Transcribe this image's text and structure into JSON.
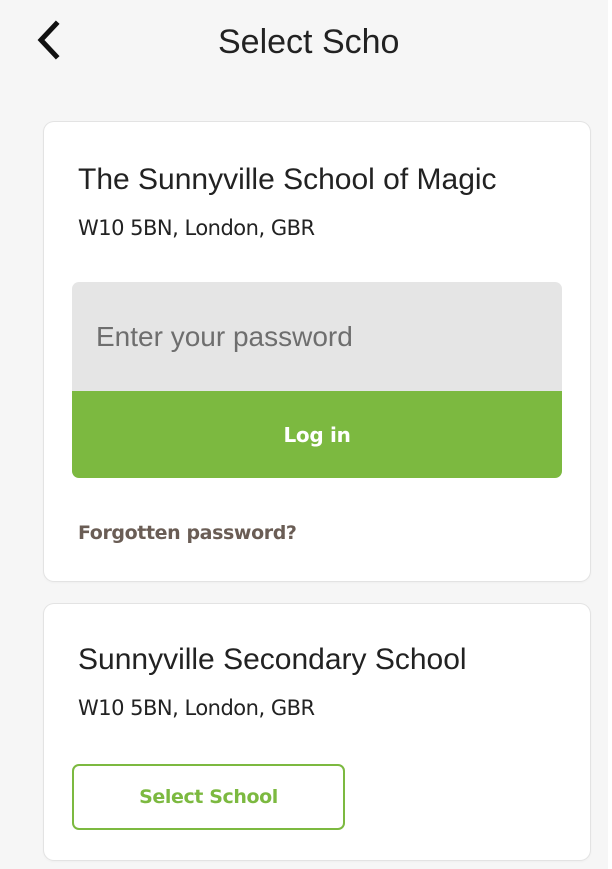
{
  "header": {
    "title": "Select Scho",
    "back_icon": "chevron-left-icon"
  },
  "schools": [
    {
      "name": "The Sunnyville School of Magic",
      "address": "W10 5BN, London, GBR",
      "password_placeholder": "Enter your password",
      "password_value": "",
      "login_label": "Log in",
      "forgot_label": "Forgotten password?"
    },
    {
      "name": "Sunnyville Secondary School",
      "address": "W10 5BN, London, GBR",
      "select_label": "Select School"
    }
  ],
  "colors": {
    "accent_green": "#7cb940",
    "link_brown": "#6a5d55",
    "background": "#f6f6f6",
    "input_background": "#e5e5e5"
  }
}
